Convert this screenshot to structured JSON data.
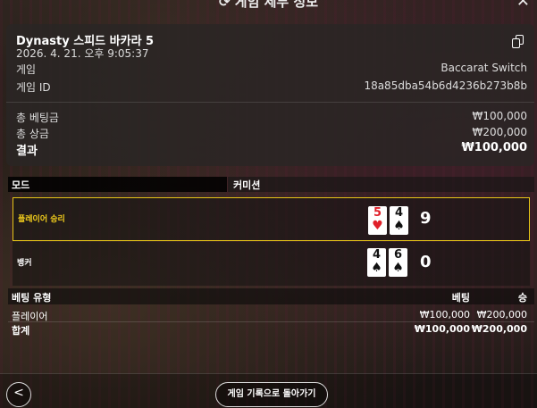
{
  "header": {
    "title": "게임 세부 정보",
    "title_icon": "replay-icon",
    "close_icon": "close-icon"
  },
  "summary": {
    "game_name": "Dynasty 스피드 바카라 5",
    "datetime": "2026. 4. 21. 오후 9:05:37",
    "copy_icon": "copy-icon",
    "game_label": "게임",
    "game_value": "Baccarat Switch",
    "game_id_label": "게임 ID",
    "game_id_value": "18a85dba54b6d4236b273b8b",
    "total_bet_label": "총 베팅금",
    "total_bet_value": "₩100,000",
    "total_win_label": "총 상금",
    "total_win_value": "₩200,000",
    "result_label": "결과",
    "result_value": "₩100,000"
  },
  "mode": {
    "label": "모드",
    "value": "커미션"
  },
  "hands": [
    {
      "label": "플레이어 승리",
      "winner": true,
      "cards": [
        {
          "rank": "5",
          "suit": "♥",
          "color": "red"
        },
        {
          "rank": "4",
          "suit": "♠",
          "color": "black"
        }
      ],
      "score": "9"
    },
    {
      "label": "뱅커",
      "winner": false,
      "cards": [
        {
          "rank": "4",
          "suit": "♠",
          "color": "black"
        },
        {
          "rank": "6",
          "suit": "♠",
          "color": "black"
        }
      ],
      "score": "0"
    }
  ],
  "bets": {
    "headers": [
      "베팅 유형",
      "베팅",
      "승"
    ],
    "rows": [
      {
        "type": "플레이어",
        "bet": "₩100,000",
        "win": "₩200,000"
      }
    ],
    "total": {
      "type": "합계",
      "bet": "₩100,000",
      "win": "₩200,000"
    }
  },
  "footer": {
    "back_icon": "chevron-left-icon",
    "history_button": "게임 기록으로 돌아가기"
  },
  "colors": {
    "win_highlight": "#e6c418",
    "red_suit": "#e0202a"
  }
}
